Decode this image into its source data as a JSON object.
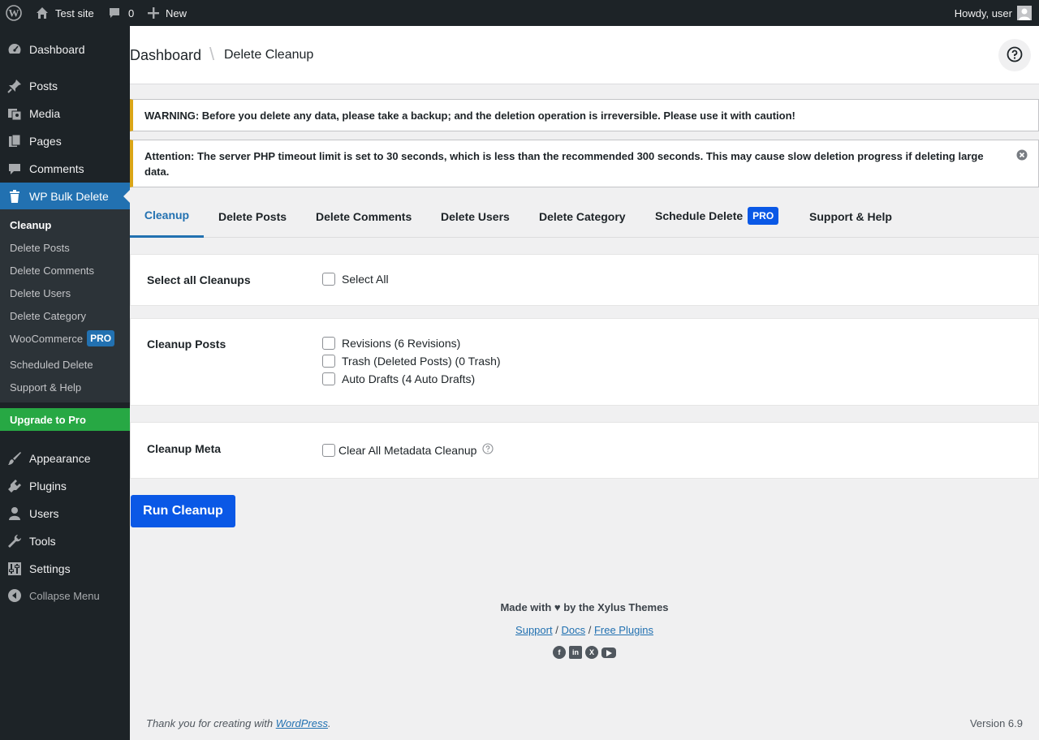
{
  "adminbar": {
    "site_name": "Test site",
    "comments_count": "0",
    "new_label": "New",
    "greeting": "Howdy, user"
  },
  "sidebar": {
    "items": [
      {
        "label": "Dashboard",
        "icon": "dashboard-icon"
      },
      {
        "label": "Posts",
        "icon": "pin-icon"
      },
      {
        "label": "Media",
        "icon": "media-icon"
      },
      {
        "label": "Pages",
        "icon": "pages-icon"
      },
      {
        "label": "Comments",
        "icon": "comment-icon"
      },
      {
        "label": "WP Bulk Delete",
        "icon": "trash-icon"
      }
    ],
    "submenu": [
      "Cleanup",
      "Delete Posts",
      "Delete Comments",
      "Delete Users",
      "Delete Category",
      "WooCommerce",
      "Scheduled Delete",
      "Support & Help"
    ],
    "woocommerce_badge": "PRO",
    "upgrade_label": "Upgrade to Pro",
    "lower_items": [
      {
        "label": "Appearance",
        "icon": "brush-icon"
      },
      {
        "label": "Plugins",
        "icon": "plug-icon"
      },
      {
        "label": "Users",
        "icon": "user-icon"
      },
      {
        "label": "Tools",
        "icon": "wrench-icon"
      },
      {
        "label": "Settings",
        "icon": "settings-icon"
      }
    ],
    "collapse_label": "Collapse Menu"
  },
  "header": {
    "crumb_root": "Dashboard",
    "crumb_sep": "\\",
    "crumb_current": "Delete Cleanup"
  },
  "notices": {
    "warning": "WARNING: Before you delete any data, please take a backup; and the deletion operation is irreversible. Please use it with caution!",
    "attention": "Attention: The server PHP timeout limit is set to 30 seconds, which is less than the recommended 300 seconds. This may cause slow deletion progress if deleting large data."
  },
  "tabs": [
    {
      "label": "Cleanup",
      "active": true
    },
    {
      "label": "Delete Posts"
    },
    {
      "label": "Delete Comments"
    },
    {
      "label": "Delete Users"
    },
    {
      "label": "Delete Category"
    },
    {
      "label": "Schedule Delete",
      "badge": "PRO"
    },
    {
      "label": "Support & Help"
    }
  ],
  "sections": {
    "select_all": {
      "label": "Select all Cleanups",
      "option": "Select All"
    },
    "posts": {
      "label": "Cleanup Posts",
      "options": [
        "Revisions (6 Revisions)",
        "Trash (Deleted Posts) (0 Trash)",
        "Auto Drafts (4 Auto Drafts)"
      ]
    },
    "meta": {
      "label": "Cleanup Meta",
      "option": "Clear All Metadata Cleanup"
    }
  },
  "run_button": "Run Cleanup",
  "plugin_footer": {
    "made_with": "Made with ♥ by the Xylus Themes",
    "links": [
      "Support",
      "Docs",
      "Free Plugins"
    ],
    "link_sep": "/",
    "socials": [
      "facebook-icon",
      "linkedin-icon",
      "x-icon",
      "youtube-icon"
    ]
  },
  "wp_footer": {
    "thanks_prefix": "Thank you for creating with ",
    "thanks_link": "WordPress",
    "thanks_suffix": ".",
    "version": "Version 6.9"
  },
  "colors": {
    "admin_dark": "#1d2327",
    "accent": "#2271b1",
    "warning_border": "#dba617",
    "upgrade_green": "#27a844",
    "run_button": "#0a58e6"
  }
}
